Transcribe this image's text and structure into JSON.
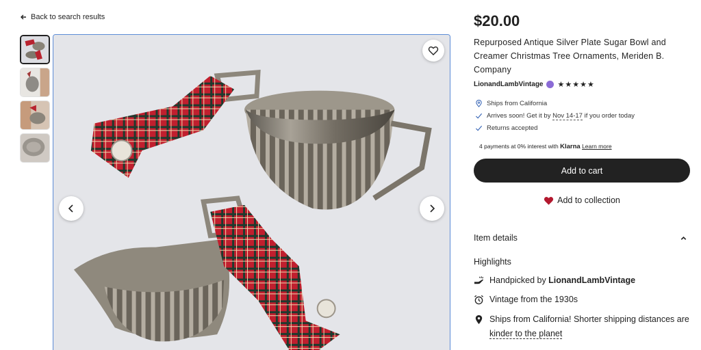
{
  "nav": {
    "back_label": "Back to search results"
  },
  "gallery": {
    "thumbnails": [
      "thumb-1",
      "thumb-2",
      "thumb-3",
      "thumb-4"
    ],
    "active_index": 0
  },
  "listing": {
    "price": "$20.00",
    "title": "Repurposed Antique Silver Plate Sugar Bowl and Creamer Christmas Tree Ornaments, Meriden B. Company",
    "shop_name": "LionandLambVintage",
    "stars": "★★★★★"
  },
  "shipping": {
    "ships_from": "Ships from California",
    "arrives_prefix": "Arrives soon! Get it by ",
    "arrives_dates": "Nov 14-17",
    "arrives_suffix": " if you order today",
    "returns": "Returns accepted"
  },
  "klarna": {
    "prefix": "4 payments at 0% interest with ",
    "brand": "Klarna",
    "learn_more": "Learn more"
  },
  "actions": {
    "add_to_cart": "Add to cart",
    "add_to_collection": "Add to collection"
  },
  "details": {
    "heading": "Item details",
    "highlights_title": "Highlights",
    "handpicked_prefix": "Handpicked by ",
    "handpicked_shop": "LionandLambVintage",
    "vintage": "Vintage from the 1930s",
    "ships_note": "Ships from California! Shorter shipping distances are ",
    "ships_link": "kinder to the planet"
  },
  "colors": {
    "accent": "#222222",
    "heart": "#b3182e",
    "selection": "#5b8bd6"
  }
}
